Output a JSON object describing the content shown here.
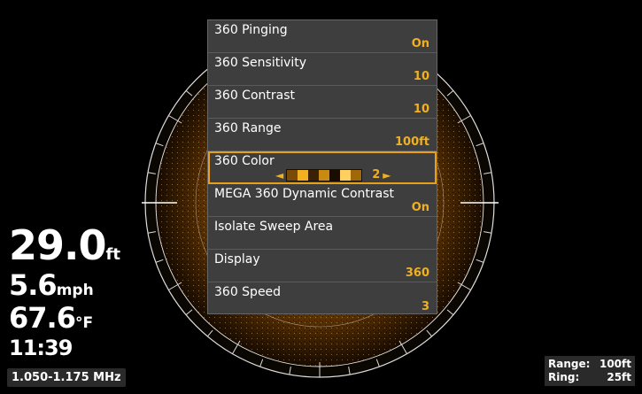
{
  "readouts": {
    "depth_value": "29.0",
    "depth_unit": "ft",
    "speed_value": "5.6",
    "speed_unit": "mph",
    "temp_value": "67.6",
    "temp_unit": "°F",
    "time": "11:39"
  },
  "frequency": "1.050-1.175 MHz",
  "range_box": {
    "range_label": "Range:",
    "range_value": "100ft",
    "ring_label": "Ring:",
    "ring_value": "25ft"
  },
  "menu": {
    "items": [
      {
        "label": "360 Pinging",
        "value": "On"
      },
      {
        "label": "360 Sensitivity",
        "value": "10"
      },
      {
        "label": "360 Contrast",
        "value": "10"
      },
      {
        "label": "360 Range",
        "value": "100ft"
      },
      {
        "label": "360 Color",
        "value": "2"
      },
      {
        "label": "MEGA 360 Dynamic Contrast",
        "value": "On"
      },
      {
        "label": "Isolate Sweep Area",
        "value": ""
      },
      {
        "label": "Display",
        "value": "360"
      },
      {
        "label": "360 Speed",
        "value": "3"
      }
    ],
    "selected_index": 4
  },
  "colors": {
    "accent": "#f0b020",
    "menu_bg": "#3e3e3e",
    "sonar": "#c8820a"
  }
}
